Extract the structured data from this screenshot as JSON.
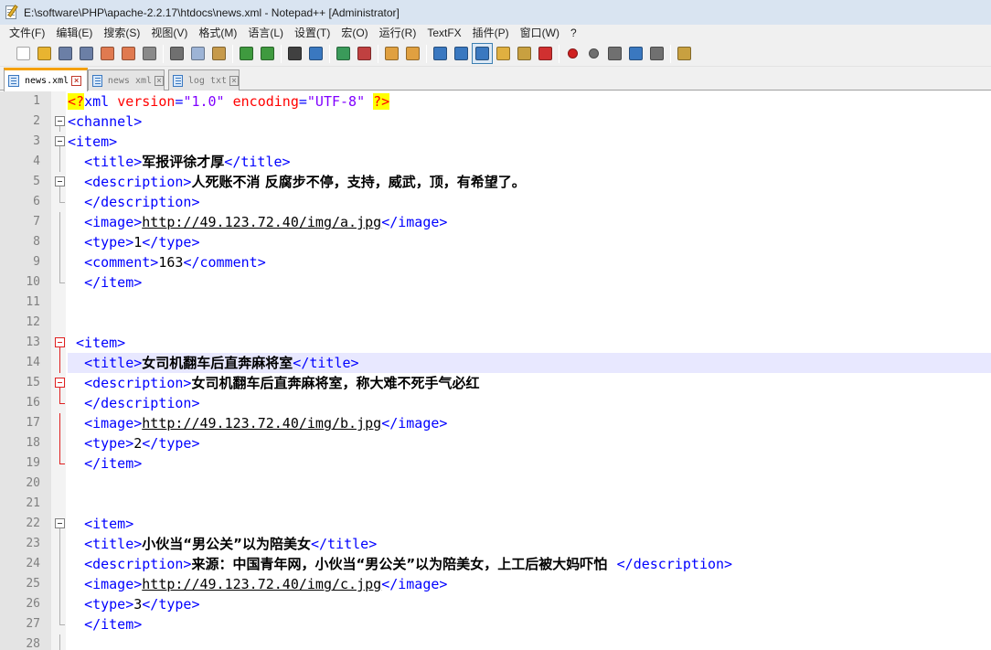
{
  "window": {
    "title": "E:\\software\\PHP\\apache-2.2.17\\htdocs\\news.xml - Notepad++ [Administrator]"
  },
  "menu": [
    "文件(F)",
    "编辑(E)",
    "搜索(S)",
    "视图(V)",
    "格式(M)",
    "语言(L)",
    "设置(T)",
    "宏(O)",
    "运行(R)",
    "TextFX",
    "插件(P)",
    "窗口(W)",
    "?"
  ],
  "toolbar": {
    "buttons": [
      {
        "icon": "new-file-icon",
        "color": "#ffffff"
      },
      {
        "icon": "open-file-icon",
        "color": "#e8b430"
      },
      {
        "icon": "save-icon",
        "color": "#6b7fa6"
      },
      {
        "icon": "save-all-icon",
        "color": "#6b7fa6"
      },
      {
        "icon": "close-icon",
        "color": "#e07a50"
      },
      {
        "icon": "close-all-icon",
        "color": "#e07a50"
      },
      {
        "icon": "print-icon",
        "color": "#8a8a8a"
      },
      {
        "sep": true
      },
      {
        "icon": "cut-icon",
        "color": "#707070"
      },
      {
        "icon": "copy-icon",
        "color": "#9db4d6"
      },
      {
        "icon": "paste-icon",
        "color": "#c69a4b"
      },
      {
        "sep": true
      },
      {
        "icon": "undo-icon",
        "color": "#3f9a3f"
      },
      {
        "icon": "redo-icon",
        "color": "#3f9a3f"
      },
      {
        "sep": true
      },
      {
        "icon": "find-icon",
        "color": "#404040"
      },
      {
        "icon": "replace-icon",
        "color": "#3a78c0"
      },
      {
        "sep": true
      },
      {
        "icon": "zoom-in-icon",
        "color": "#3a9a5a"
      },
      {
        "icon": "zoom-out-icon",
        "color": "#c04040"
      },
      {
        "sep": true
      },
      {
        "icon": "sync-vertical-icon",
        "color": "#e0a040"
      },
      {
        "icon": "sync-horizontal-icon",
        "color": "#e0a040"
      },
      {
        "sep": true
      },
      {
        "icon": "word-wrap-icon",
        "color": "#3a78c0"
      },
      {
        "icon": "show-all-chars-icon",
        "color": "#3a78c0"
      },
      {
        "icon": "indent-guide-icon",
        "color": "#3a78c0",
        "active": true
      },
      {
        "icon": "user-lang-icon",
        "color": "#e0b040"
      },
      {
        "icon": "doc-map-icon",
        "color": "#c8a040"
      },
      {
        "icon": "function-list-icon",
        "color": "#d03030"
      },
      {
        "sep": true
      },
      {
        "icon": "record-macro-icon",
        "color": "#d02020"
      },
      {
        "icon": "stop-record-icon",
        "color": "#707070"
      },
      {
        "icon": "play-macro-icon",
        "color": "#707070"
      },
      {
        "icon": "run-macro-multiple-icon",
        "color": "#3a78c0"
      },
      {
        "icon": "save-macro-icon",
        "color": "#707070"
      },
      {
        "sep": true
      },
      {
        "icon": "spell-check-icon",
        "color": "#c8a040"
      }
    ]
  },
  "tabs": [
    {
      "label": "news.xml",
      "active": true
    },
    {
      "label": "news xml",
      "active": false
    },
    {
      "label": "log txt",
      "active": false
    }
  ],
  "editor": {
    "current_line": 14,
    "lines": [
      {
        "n": "1",
        "fold": "",
        "tokens": [
          [
            "decl",
            "<?"
          ],
          [
            "tag",
            "xml"
          ],
          [
            "sp",
            " "
          ],
          [
            "attr",
            "version"
          ],
          [
            "tag",
            "="
          ],
          [
            "val",
            "\"1.0\""
          ],
          [
            "sp",
            " "
          ],
          [
            "attr",
            "encoding"
          ],
          [
            "tag",
            "="
          ],
          [
            "val",
            "\"UTF-8\""
          ],
          [
            "sp",
            " "
          ],
          [
            "decl",
            "?>"
          ]
        ]
      },
      {
        "n": "2",
        "fold": "box",
        "tokens": [
          [
            "tag",
            "<channel>"
          ]
        ]
      },
      {
        "n": "3",
        "fold": "box",
        "tokens": [
          [
            "tag",
            "<item>"
          ]
        ]
      },
      {
        "n": "4",
        "fold": "line",
        "tokens": [
          [
            "sp",
            "  "
          ],
          [
            "tag",
            "<title>"
          ],
          [
            "txt",
            "军报评徐才厚"
          ],
          [
            "tag",
            "</title>"
          ]
        ]
      },
      {
        "n": "5",
        "fold": "box",
        "tokens": [
          [
            "sp",
            "  "
          ],
          [
            "tag",
            "<description>"
          ],
          [
            "txt",
            "人死账不消 反腐步不停，支持，威武，顶，有希望了。"
          ]
        ]
      },
      {
        "n": "6",
        "fold": "end",
        "tokens": [
          [
            "sp",
            "  "
          ],
          [
            "tag",
            "</description>"
          ]
        ]
      },
      {
        "n": "7",
        "fold": "line",
        "tokens": [
          [
            "sp",
            "  "
          ],
          [
            "tag",
            "<image>"
          ],
          [
            "url",
            "http://49.123.72.40/img/a.jpg"
          ],
          [
            "tag",
            "</image>"
          ]
        ]
      },
      {
        "n": "8",
        "fold": "line",
        "tokens": [
          [
            "sp",
            "  "
          ],
          [
            "tag",
            "<type>"
          ],
          [
            "plain",
            "1"
          ],
          [
            "tag",
            "</type>"
          ]
        ]
      },
      {
        "n": "9",
        "fold": "line",
        "tokens": [
          [
            "sp",
            "  "
          ],
          [
            "tag",
            "<comment>"
          ],
          [
            "plain",
            "163"
          ],
          [
            "tag",
            "</comment>"
          ]
        ]
      },
      {
        "n": "10",
        "fold": "end",
        "tokens": [
          [
            "sp",
            "  "
          ],
          [
            "tag",
            "</item>"
          ]
        ]
      },
      {
        "n": "11",
        "fold": "",
        "tokens": []
      },
      {
        "n": "12",
        "fold": "",
        "tokens": []
      },
      {
        "n": "13",
        "fold": "box-red",
        "tokens": [
          [
            "sp",
            " "
          ],
          [
            "tag",
            "<item>"
          ]
        ]
      },
      {
        "n": "14",
        "fold": "line-red",
        "tokens": [
          [
            "sp",
            "  "
          ],
          [
            "tag",
            "<title>"
          ],
          [
            "txt",
            "女司机翻车后直奔麻将室"
          ],
          [
            "tag",
            "</title>"
          ]
        ]
      },
      {
        "n": "15",
        "fold": "box-red",
        "tokens": [
          [
            "sp",
            "  "
          ],
          [
            "tag",
            "<description>"
          ],
          [
            "txt",
            "女司机翻车后直奔麻将室，称大难不死手气必红"
          ]
        ]
      },
      {
        "n": "16",
        "fold": "end-red",
        "tokens": [
          [
            "sp",
            "  "
          ],
          [
            "tag",
            "</description>"
          ]
        ]
      },
      {
        "n": "17",
        "fold": "line-red",
        "tokens": [
          [
            "sp",
            "  "
          ],
          [
            "tag",
            "<image>"
          ],
          [
            "url",
            "http://49.123.72.40/img/b.jpg"
          ],
          [
            "tag",
            "</image>"
          ]
        ]
      },
      {
        "n": "18",
        "fold": "line-red",
        "tokens": [
          [
            "sp",
            "  "
          ],
          [
            "tag",
            "<type>"
          ],
          [
            "plain",
            "2"
          ],
          [
            "tag",
            "</type>"
          ]
        ]
      },
      {
        "n": "19",
        "fold": "end-red",
        "tokens": [
          [
            "sp",
            "  "
          ],
          [
            "tag",
            "</item>"
          ]
        ]
      },
      {
        "n": "20",
        "fold": "",
        "tokens": []
      },
      {
        "n": "21",
        "fold": "",
        "tokens": []
      },
      {
        "n": "22",
        "fold": "box",
        "tokens": [
          [
            "sp",
            "  "
          ],
          [
            "tag",
            "<item>"
          ]
        ]
      },
      {
        "n": "23",
        "fold": "line",
        "tokens": [
          [
            "sp",
            "  "
          ],
          [
            "tag",
            "<title>"
          ],
          [
            "txt",
            "小伙当“男公关”以为陪美女"
          ],
          [
            "tag",
            "</title>"
          ]
        ]
      },
      {
        "n": "24",
        "fold": "line",
        "tokens": [
          [
            "sp",
            "  "
          ],
          [
            "tag",
            "<description>"
          ],
          [
            "txt",
            "来源：中国青年网，小伙当“男公关”以为陪美女，上工后被大妈吓怕  "
          ],
          [
            "tag",
            "</description>"
          ]
        ]
      },
      {
        "n": "25",
        "fold": "line",
        "tokens": [
          [
            "sp",
            "  "
          ],
          [
            "tag",
            "<image>"
          ],
          [
            "url",
            "http://49.123.72.40/img/c.jpg"
          ],
          [
            "tag",
            "</image>"
          ]
        ]
      },
      {
        "n": "26",
        "fold": "line",
        "tokens": [
          [
            "sp",
            "  "
          ],
          [
            "tag",
            "<type>"
          ],
          [
            "plain",
            "3"
          ],
          [
            "tag",
            "</type>"
          ]
        ]
      },
      {
        "n": "27",
        "fold": "end",
        "tokens": [
          [
            "sp",
            "  "
          ],
          [
            "tag",
            "</item>"
          ]
        ]
      },
      {
        "n": "28",
        "fold": "line",
        "tokens": []
      }
    ]
  }
}
